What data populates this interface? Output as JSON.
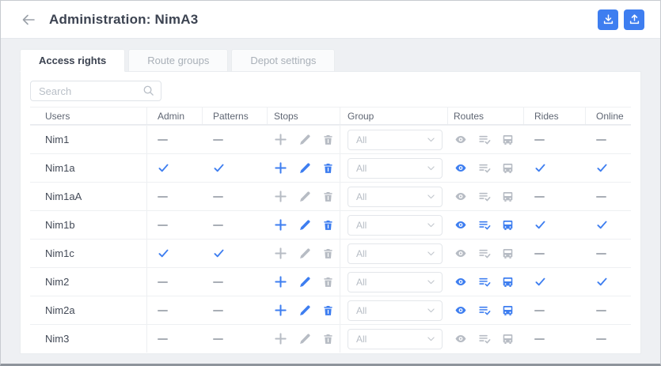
{
  "header": {
    "title": "Administration: NimA3",
    "back_icon": "arrow-left-icon",
    "actions": [
      {
        "name": "download",
        "icon": "download-icon"
      },
      {
        "name": "upload",
        "icon": "upload-icon"
      }
    ]
  },
  "tabs": [
    {
      "label": "Access rights",
      "active": true
    },
    {
      "label": "Route groups",
      "active": false
    },
    {
      "label": "Depot settings",
      "active": false
    }
  ],
  "search": {
    "placeholder": "Search",
    "value": "",
    "icon": "search-icon"
  },
  "table": {
    "columns": [
      "Users",
      "Admin",
      "Patterns",
      "Stops",
      "Group",
      "Routes",
      "Rides",
      "Online"
    ],
    "stops_action_icons": [
      "plus-icon",
      "pencil-icon",
      "trash-icon"
    ],
    "routes_action_icons": [
      "eye-icon",
      "route-check-icon",
      "bus-icon"
    ],
    "group_options_visible": [
      "All"
    ],
    "rows": [
      {
        "user": "Nim1",
        "admin": false,
        "patterns": false,
        "stops": {
          "add": false,
          "edit": false,
          "delete": false
        },
        "group": "All",
        "routes": {
          "view": false,
          "assign": false,
          "vehicle": false
        },
        "rides": false,
        "online": false
      },
      {
        "user": "Nim1a",
        "admin": true,
        "patterns": true,
        "stops": {
          "add": true,
          "edit": true,
          "delete": true
        },
        "group": "All",
        "routes": {
          "view": true,
          "assign": false,
          "vehicle": false
        },
        "rides": true,
        "online": true
      },
      {
        "user": "Nim1aA",
        "admin": false,
        "patterns": false,
        "stops": {
          "add": false,
          "edit": false,
          "delete": false
        },
        "group": "All",
        "routes": {
          "view": false,
          "assign": false,
          "vehicle": false
        },
        "rides": false,
        "online": false
      },
      {
        "user": "Nim1b",
        "admin": false,
        "patterns": false,
        "stops": {
          "add": true,
          "edit": true,
          "delete": true
        },
        "group": "All",
        "routes": {
          "view": true,
          "assign": true,
          "vehicle": true
        },
        "rides": true,
        "online": true
      },
      {
        "user": "Nim1c",
        "admin": true,
        "patterns": true,
        "stops": {
          "add": false,
          "edit": false,
          "delete": false
        },
        "group": "All",
        "routes": {
          "view": false,
          "assign": false,
          "vehicle": false
        },
        "rides": false,
        "online": false
      },
      {
        "user": "Nim2",
        "admin": false,
        "patterns": false,
        "stops": {
          "add": true,
          "edit": true,
          "delete": false
        },
        "group": "All",
        "routes": {
          "view": true,
          "assign": true,
          "vehicle": true
        },
        "rides": true,
        "online": true
      },
      {
        "user": "Nim2a",
        "admin": false,
        "patterns": false,
        "stops": {
          "add": true,
          "edit": true,
          "delete": true
        },
        "group": "All",
        "routes": {
          "view": true,
          "assign": true,
          "vehicle": true
        },
        "rides": false,
        "online": false
      },
      {
        "user": "Nim3",
        "admin": false,
        "patterns": false,
        "stops": {
          "add": false,
          "edit": false,
          "delete": false
        },
        "group": "All",
        "routes": {
          "view": false,
          "assign": false,
          "vehicle": false
        },
        "rides": false,
        "online": false
      }
    ]
  },
  "colors": {
    "accent": "#3e7ef0",
    "icon_disabled": "#b7bcc4",
    "dash": "#a9aeb6",
    "text": "#434a57"
  }
}
